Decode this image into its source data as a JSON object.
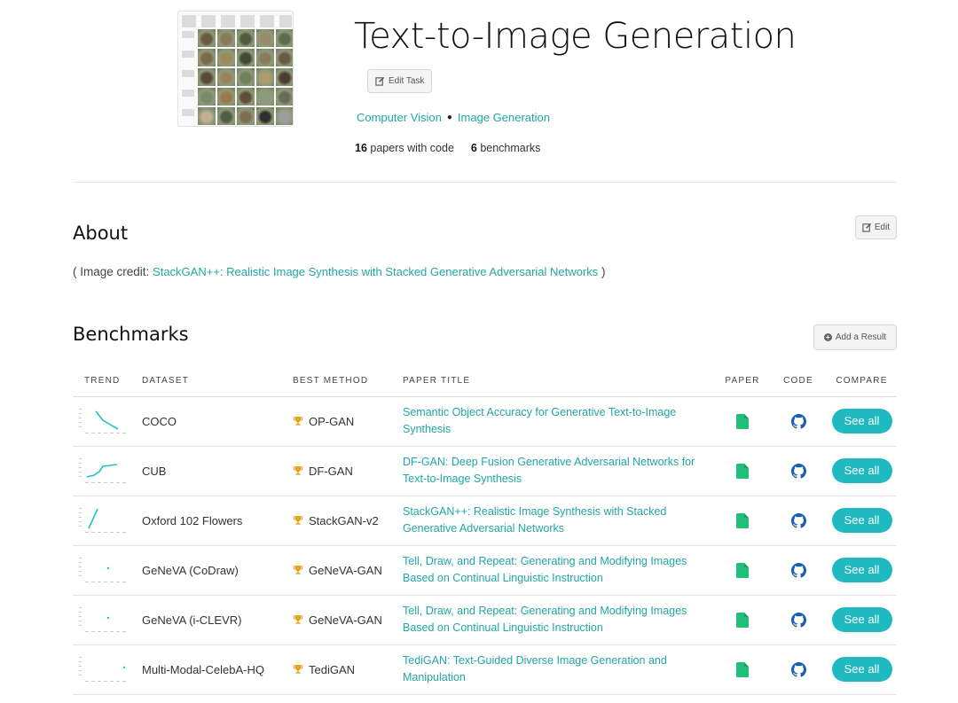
{
  "header": {
    "title": "Text-to-Image Generation",
    "edit_task_label": "Edit Task",
    "tags": [
      "Computer Vision",
      "Image Generation"
    ],
    "papers_count": "16",
    "papers_label": "papers with code",
    "benchmarks_count": "6",
    "benchmarks_label": "benchmarks"
  },
  "about": {
    "title": "About",
    "edit_label": "Edit",
    "credit_prefix": "( Image credit:",
    "credit_link": "StackGAN++: Realistic Image Synthesis with Stacked Generative Adversarial Networks",
    "credit_suffix": ")"
  },
  "benchmarks": {
    "title": "Benchmarks",
    "add_result_label": "Add a Result",
    "columns": {
      "trend": "TREND",
      "dataset": "DATASET",
      "best_method": "BEST METHOD",
      "paper_title": "PAPER TITLE",
      "paper": "PAPER",
      "code": "CODE",
      "compare": "COMPARE"
    },
    "rows": [
      {
        "dataset": "COCO",
        "method": "OP-GAN",
        "paper_title": "Semantic Object Accuracy for Generative Text-to-Image Synthesis",
        "compare": "See all",
        "trend": "falling"
      },
      {
        "dataset": "CUB",
        "method": "DF-GAN",
        "paper_title": "DF-GAN: Deep Fusion Generative Adversarial Networks for Text-to-Image Synthesis",
        "compare": "See all",
        "trend": "rising-steps"
      },
      {
        "dataset": "Oxford 102 Flowers",
        "method": "StackGAN-v2",
        "paper_title": "StackGAN++: Realistic Image Synthesis with Stacked Generative Adversarial Networks",
        "compare": "See all",
        "trend": "rising"
      },
      {
        "dataset": "GeNeVA (CoDraw)",
        "method": "GeNeVA-GAN",
        "paper_title": "Tell, Draw, and Repeat: Generating and Modifying Images Based on Continual Linguistic Instruction",
        "compare": "See all",
        "trend": "point"
      },
      {
        "dataset": "GeNeVA (i-CLEVR)",
        "method": "GeNeVA-GAN",
        "paper_title": "Tell, Draw, and Repeat: Generating and Modifying Images Based on Continual Linguistic Instruction",
        "compare": "See all",
        "trend": "point"
      },
      {
        "dataset": "Multi-Modal-CelebA-HQ",
        "method": "TediGAN",
        "paper_title": "TediGAN: Text-Guided Diverse Image Generation and Manipulation",
        "compare": "See all",
        "trend": "point-right"
      }
    ]
  },
  "colors": {
    "accent": "#21a7a3",
    "button": "#21b9c1",
    "paper_icon": "#21c07a",
    "code_icon": "#1a5fb4",
    "trophy": "#e8a317"
  },
  "icons": {
    "edit": "edit-icon",
    "plus": "plus-circle-icon",
    "paper": "file-icon",
    "code": "github-icon",
    "trophy": "trophy-icon"
  }
}
